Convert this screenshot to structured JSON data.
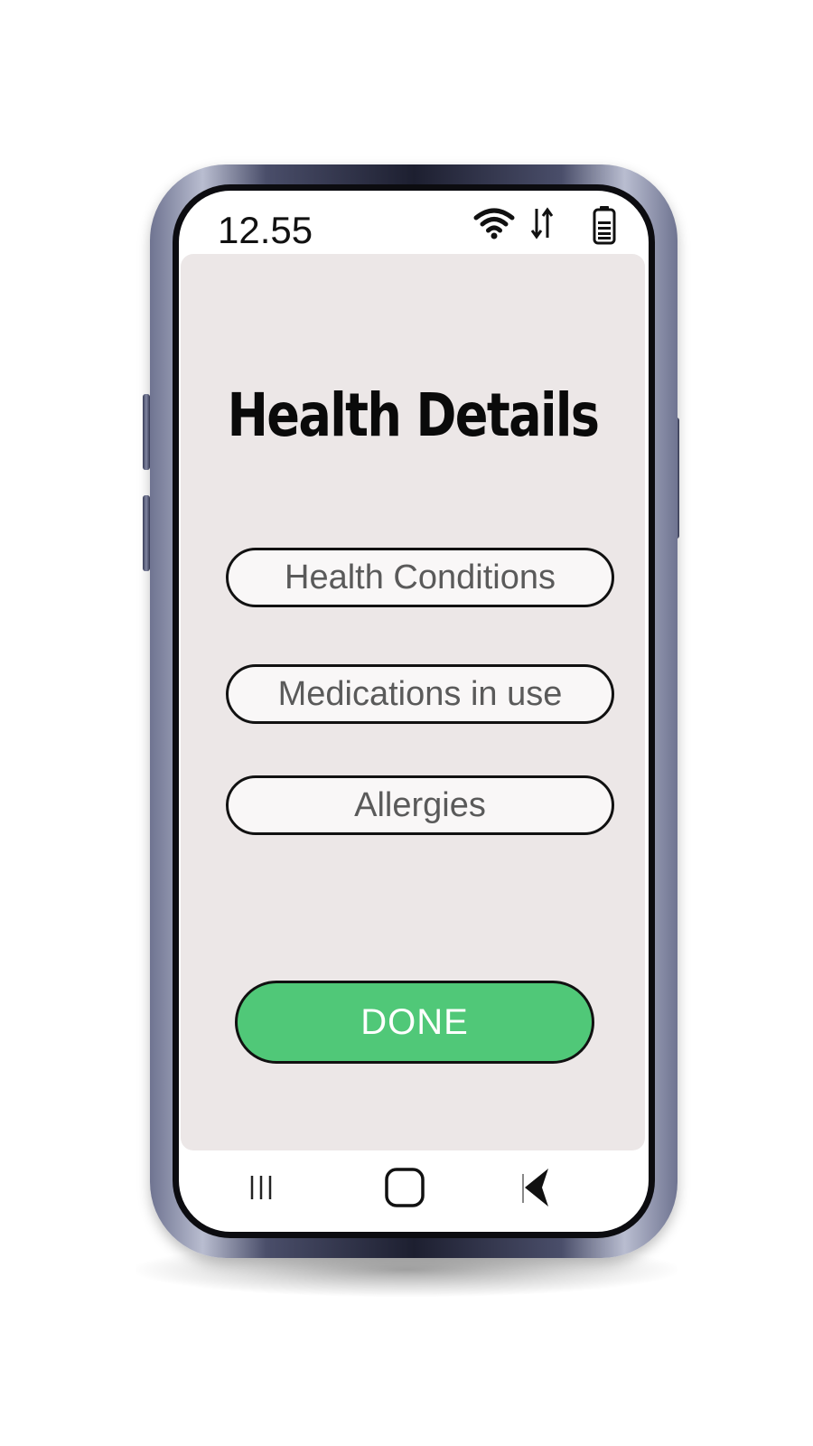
{
  "status_bar": {
    "time": "12.55",
    "icons": [
      "wifi-icon",
      "data-transfer-icon",
      "battery-icon"
    ]
  },
  "screen": {
    "title": "Health Details",
    "fields": [
      {
        "label": "Health Conditions"
      },
      {
        "label": "Medications in use"
      },
      {
        "label": "Allergies"
      }
    ],
    "done_button": {
      "label": "DONE"
    }
  },
  "nav_bar": {
    "icons": [
      "recent-apps-icon",
      "home-icon",
      "back-icon"
    ]
  },
  "colors": {
    "accent": "#50c878",
    "screen_background": "#ece7e7",
    "field_background": "#f9f7f7"
  }
}
